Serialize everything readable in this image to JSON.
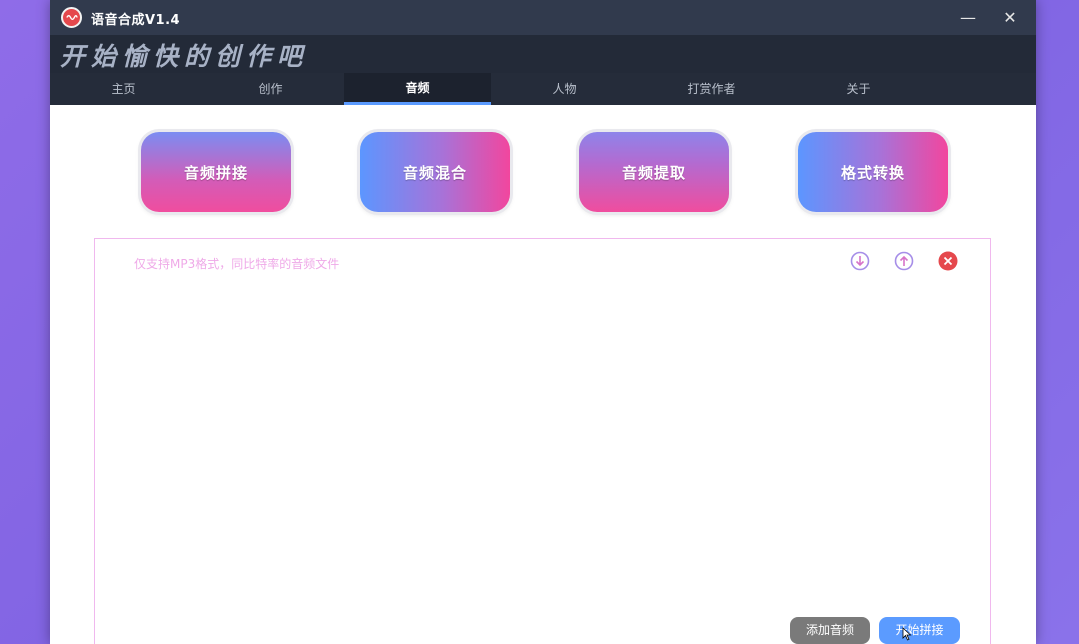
{
  "window": {
    "title": "语音合成V1.4",
    "slogan": "开始愉快的创作吧",
    "minimize_glyph": "—",
    "close_glyph": "✕"
  },
  "nav": {
    "tabs": [
      {
        "label": "主页",
        "active": false
      },
      {
        "label": "创作",
        "active": false
      },
      {
        "label": "音频",
        "active": true
      },
      {
        "label": "人物",
        "active": false
      },
      {
        "label": "打赏作者",
        "active": false
      },
      {
        "label": "关于",
        "active": false
      }
    ]
  },
  "functions": [
    {
      "label": "音频拼接"
    },
    {
      "label": "音频混合"
    },
    {
      "label": "音频提取"
    },
    {
      "label": "格式转换"
    }
  ],
  "panel": {
    "hint": "仅支持MP3格式，同比特率的音频文件",
    "icons": [
      "move-down-icon",
      "move-up-icon",
      "delete-icon"
    ]
  },
  "actions": {
    "add_label": "添加音频",
    "start_label": "开始拼接"
  },
  "colors": {
    "accent": "#5b9bff",
    "pink": "#f04d9e",
    "danger": "#e5484d",
    "title_bar": "#313a4d"
  }
}
